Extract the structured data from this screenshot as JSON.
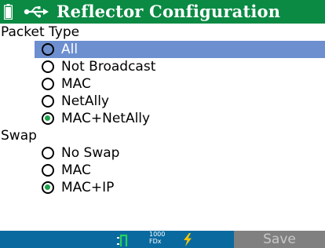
{
  "header": {
    "title": "Reflector Configuration",
    "battery_icon": "battery-icon",
    "usb_icon": "usb-icon"
  },
  "packet_type": {
    "label": "Packet Type",
    "options": [
      {
        "label": "All",
        "checked": false,
        "highlighted": true
      },
      {
        "label": "Not Broadcast",
        "checked": false
      },
      {
        "label": "MAC",
        "checked": false
      },
      {
        "label": "NetAlly",
        "checked": false
      },
      {
        "label": "MAC+NetAlly",
        "checked": true
      }
    ]
  },
  "swap": {
    "label": "Swap",
    "options": [
      {
        "label": "No Swap",
        "checked": false
      },
      {
        "label": "MAC",
        "checked": false
      },
      {
        "label": "MAC+IP",
        "checked": true
      }
    ]
  },
  "statusbar": {
    "speed_top": "1000",
    "speed_bottom": "FDx",
    "link_icon": "link-status-icon",
    "power_icon": "lightning-icon"
  },
  "footer": {
    "save_label": "Save"
  },
  "colors": {
    "header_bg": "#0a8a43",
    "highlight_bg": "#6d8fcf",
    "status_bg": "#0a6aa0",
    "save_bg": "#808080",
    "radio_dot": "#1ea34a"
  }
}
